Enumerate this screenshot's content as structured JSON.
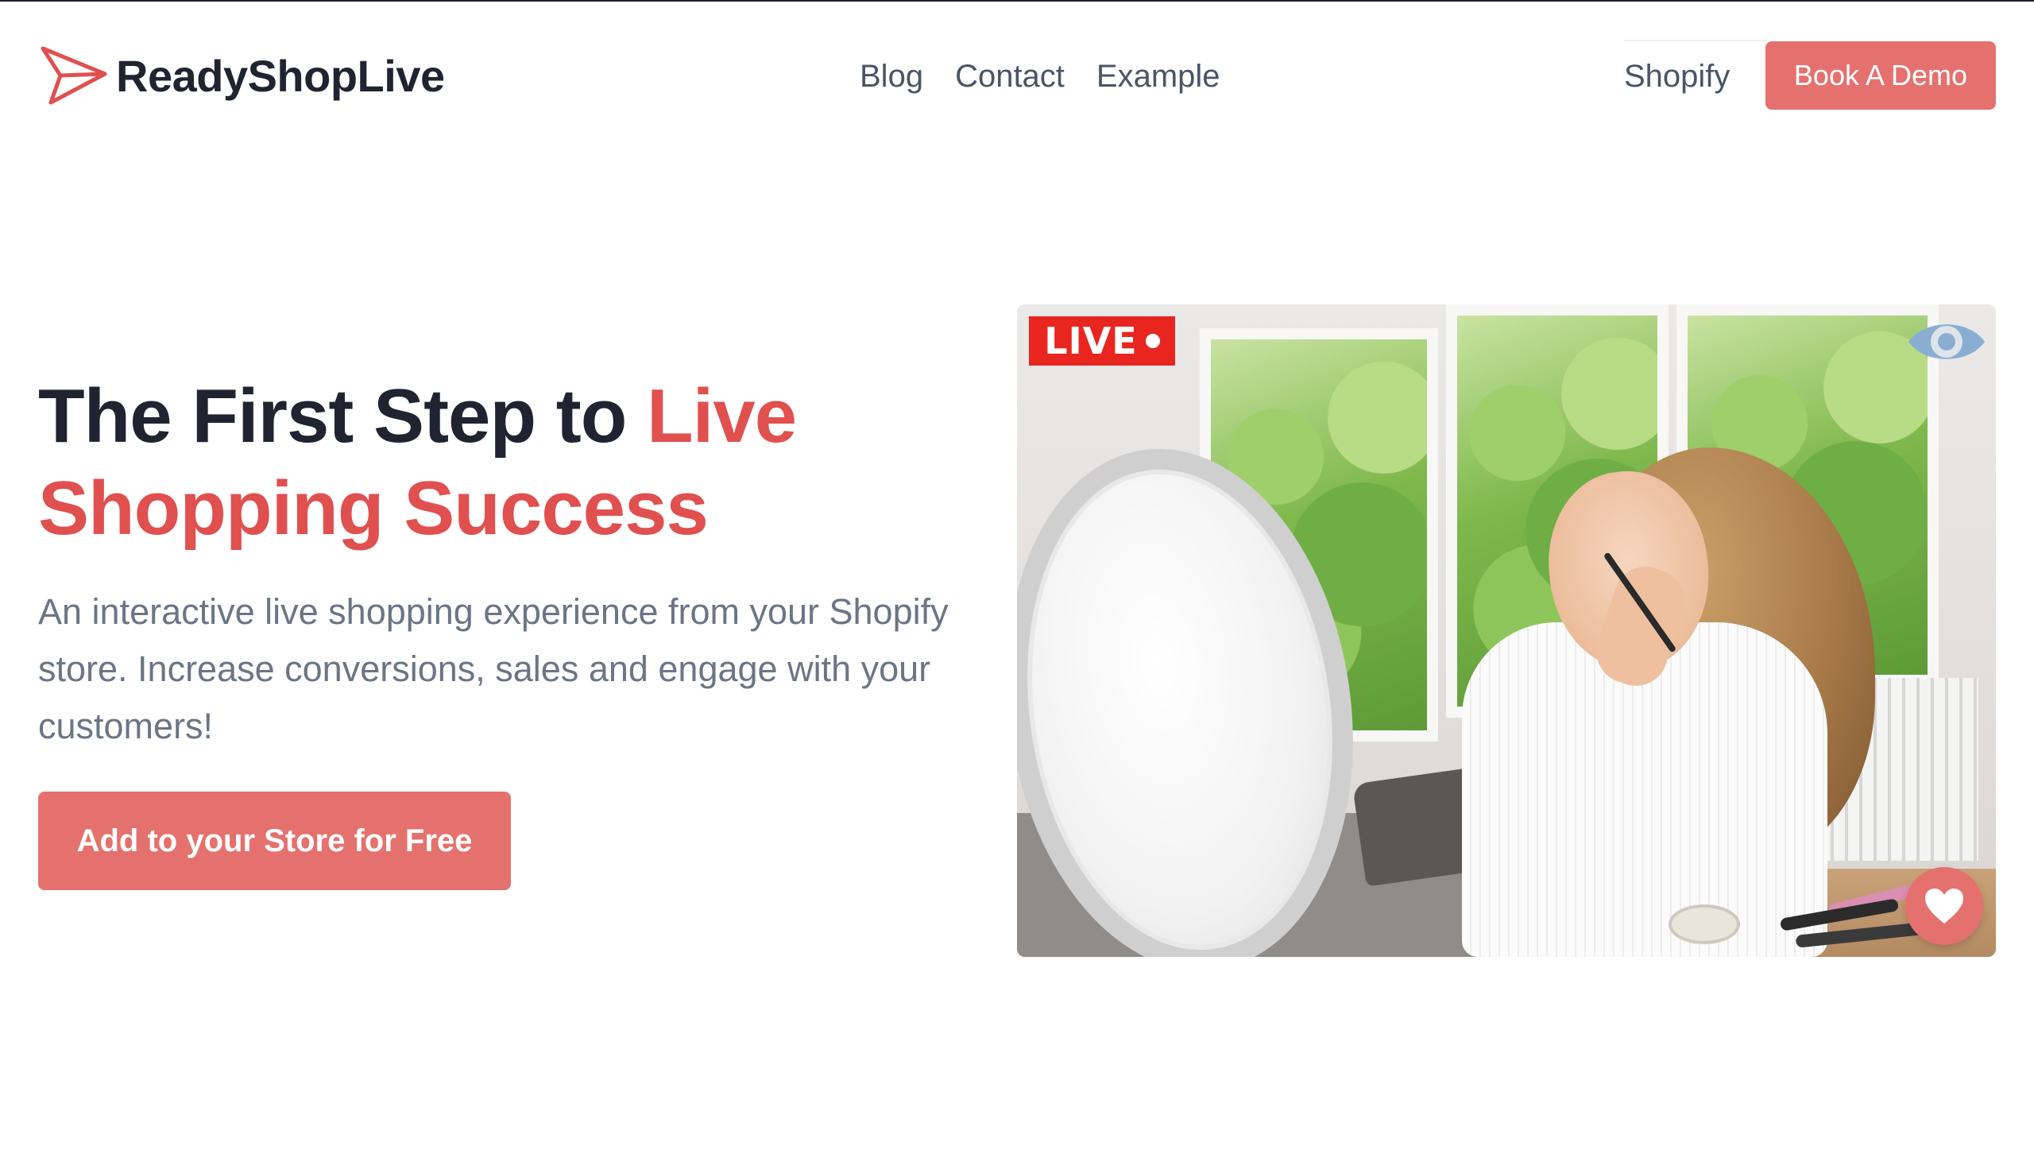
{
  "brand": {
    "name": "ReadyShopLive",
    "logo_icon": "paper-plane-play-icon",
    "accent_color": "#e0504f"
  },
  "nav": {
    "links": [
      "Blog",
      "Contact",
      "Example"
    ],
    "shopify_label": "Shopify",
    "demo_label": "Book A Demo"
  },
  "hero": {
    "title_dark": "The First Step to ",
    "title_accent": "Live Shopping Success",
    "subtitle": "An interactive live shopping experience from your Shopify store. Increase conversions, sales and engage with your customers!",
    "cta_label": "Add to your Store for Free",
    "button_color": "#e5716e"
  },
  "media": {
    "live_label": "LIVE",
    "live_color": "#e8261f",
    "view_icon": "eye-icon",
    "like_icon": "heart-icon"
  }
}
